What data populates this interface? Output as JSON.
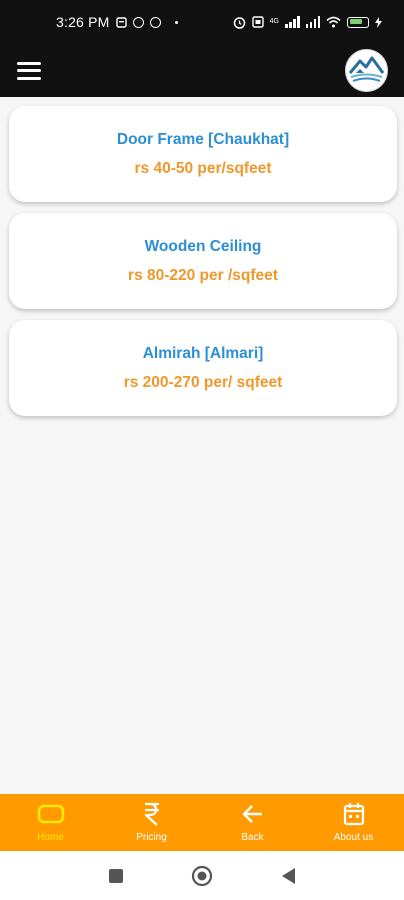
{
  "status_bar": {
    "time": "3:26 PM",
    "network_label": "4G",
    "battery_level": 0.6,
    "icons": [
      "notification-icon",
      "messenger-icon",
      "circle-app-icon",
      "alarm-icon",
      "sim-icon",
      "signal-icon",
      "wifi-icon",
      "battery-icon",
      "charging-icon"
    ]
  },
  "app_bar": {
    "menu_icon": "hamburger-icon",
    "logo_icon": "house-logo-icon"
  },
  "cards": [
    {
      "title": "Door Frame [Chaukhat]",
      "price": "rs 40-50 per/sqfeet"
    },
    {
      "title": "Wooden Ceiling",
      "price": "rs 80-220 per /sqfeet"
    },
    {
      "title": "Almirah [Almari]",
      "price": "rs 200-270 per/ sqfeet"
    }
  ],
  "bottom_nav": [
    {
      "label": "Home",
      "icon": "home-icon",
      "active": true
    },
    {
      "label": "Pricing",
      "icon": "rupee-icon",
      "active": false
    },
    {
      "label": "Back",
      "icon": "back-arrow-icon",
      "active": false
    },
    {
      "label": "About us",
      "icon": "calendar-icon",
      "active": false
    }
  ],
  "colors": {
    "app_bar": "#111111",
    "card_title": "#2c8fd6",
    "card_price": "#f0982c",
    "bottom_nav_bg": "#ff9b00",
    "bottom_nav_active": "#ffea00"
  }
}
